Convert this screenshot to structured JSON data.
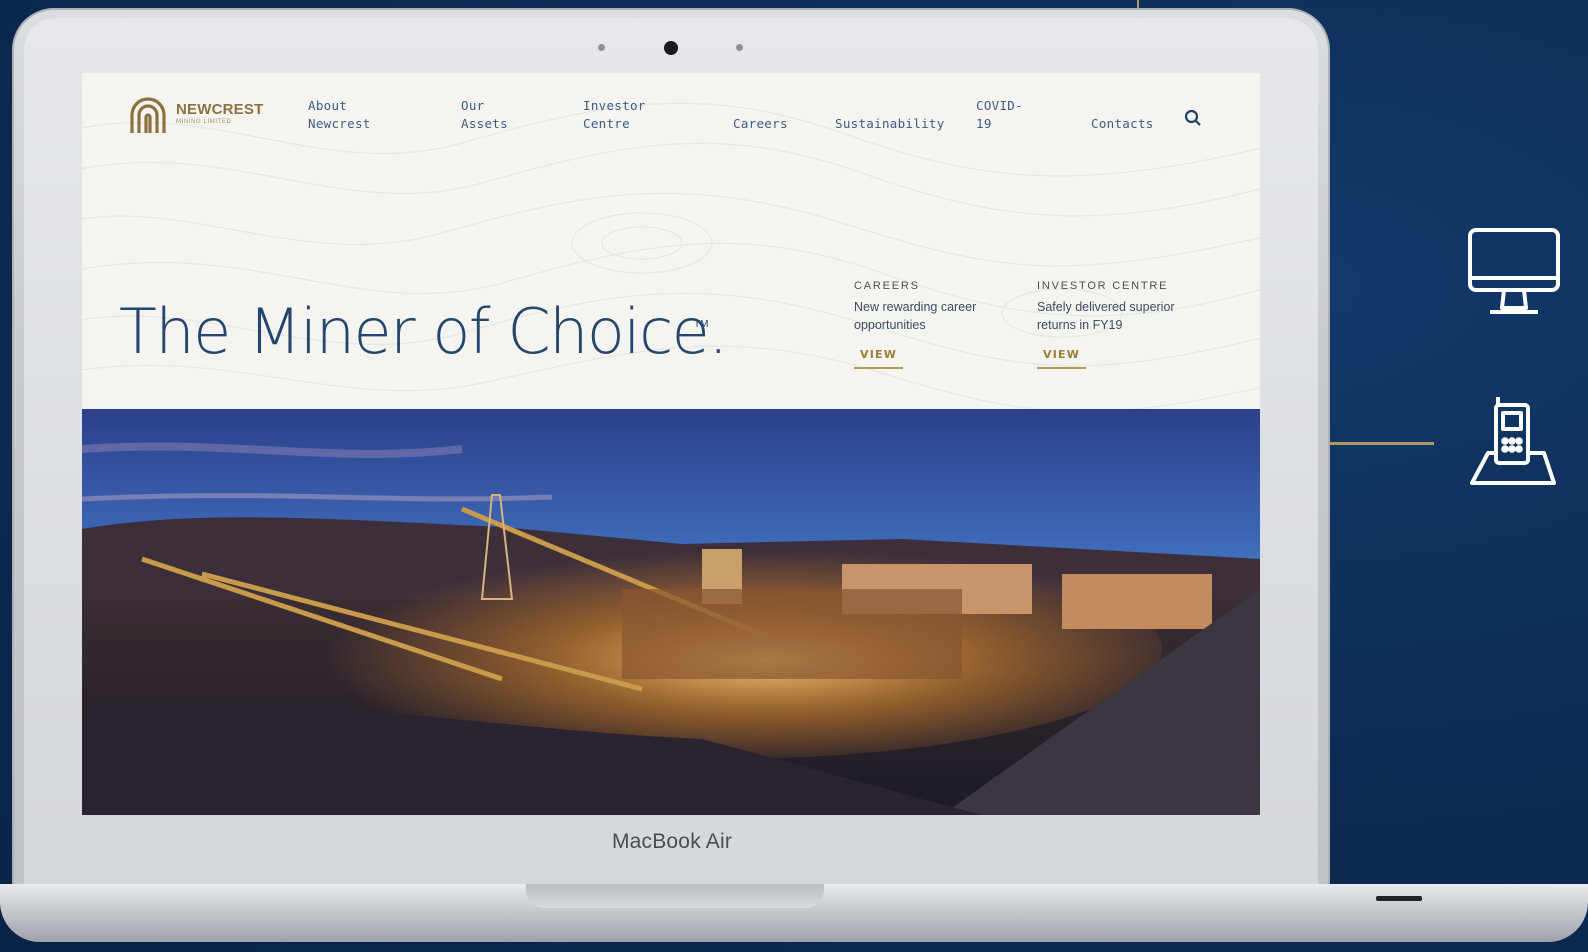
{
  "laptop": {
    "brand_label": "MacBook Air"
  },
  "site": {
    "logo": {
      "name": "NEWCREST",
      "sub": "MINING LIMITED"
    },
    "nav": [
      {
        "label": "About\nNewcrest"
      },
      {
        "label": "Our\nAssets"
      },
      {
        "label": "Investor\nCentre"
      },
      {
        "label": "Careers"
      },
      {
        "label": "Sustainability"
      },
      {
        "label": "COVID-\n19"
      },
      {
        "label": "Contacts"
      }
    ],
    "hero": {
      "title": "The Miner of Choice.",
      "trademark": "TM"
    },
    "promos": [
      {
        "label": "CAREERS",
        "text": "New rewarding career opportunities",
        "view": "VIEW"
      },
      {
        "label": "INVESTOR CENTRE",
        "text": "Safely delivered superior returns in FY19",
        "view": "VIEW"
      }
    ]
  },
  "side_icons": [
    "monitor-icon",
    "phone-icon"
  ],
  "colors": {
    "background": "#0c2a52",
    "gold": "#b09a5e",
    "navy_text": "#24466e"
  }
}
